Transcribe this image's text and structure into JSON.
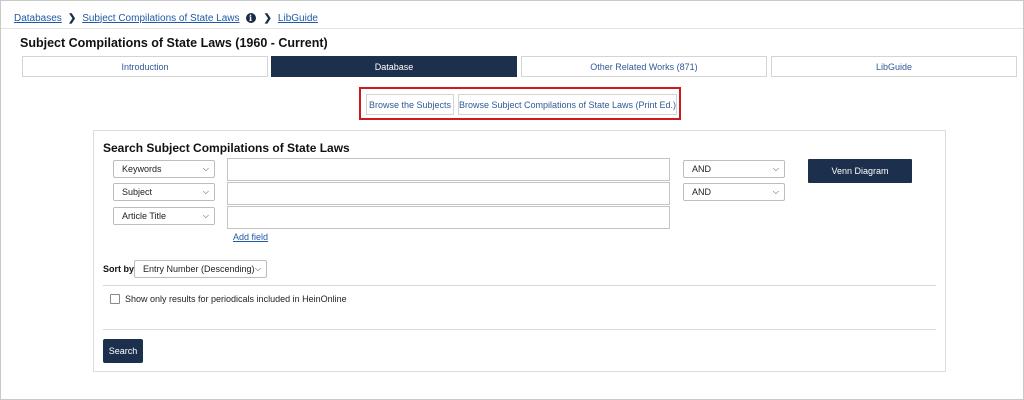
{
  "breadcrumb": {
    "items": [
      "Databases",
      "Subject Compilations of State Laws",
      "LibGuide"
    ],
    "info_icon": "info-icon",
    "separator_icon": "chevron-right-icon"
  },
  "page_title": "Subject Compilations of State Laws (1960 - Current)",
  "tabs": [
    {
      "label": "Introduction",
      "active": false
    },
    {
      "label": "Database",
      "active": true
    },
    {
      "label": "Other Related Works (871)",
      "active": false
    },
    {
      "label": "LibGuide",
      "active": false
    }
  ],
  "browse": {
    "subjects_label": "Browse the Subjects",
    "print_label": "Browse Subject Compilations of State Laws (Print Ed.)"
  },
  "search": {
    "title": "Search Subject Compilations of State Laws",
    "rows": [
      {
        "field": "Keywords",
        "value": "",
        "operator": "AND"
      },
      {
        "field": "Subject",
        "value": "",
        "operator": "AND"
      },
      {
        "field": "Article Title",
        "value": ""
      }
    ],
    "add_field_label": "Add field",
    "venn_label": "Venn Diagram",
    "sort_label": "Sort by:",
    "sort_value": "Entry Number (Descending)",
    "periodicals_label": "Show only results for periodicals included in HeinOnline",
    "periodicals_checked": false,
    "search_label": "Search"
  },
  "colors": {
    "navy": "#1c2f4d",
    "link": "#1f5aa6",
    "highlight": "#d0191b"
  }
}
